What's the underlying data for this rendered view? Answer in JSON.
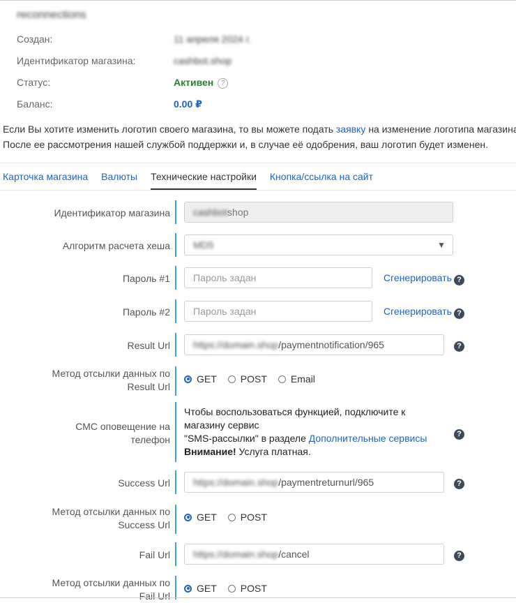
{
  "shop": {
    "title": "reconnections",
    "created_label": "Создан:",
    "created_value": "11 апреля 2024 г.",
    "id_label": "Идентификатор магазина:",
    "id_value": "cashbot.shop",
    "status_label": "Статус:",
    "status_value": "Активен",
    "status_help": "?",
    "balance_label": "Баланс:",
    "balance_value": "0.00 ₽"
  },
  "notice": {
    "line1_before": "Если Вы хотите изменить логотип своего магазина, то вы можете подать ",
    "line1_link": "заявку",
    "line1_after": " на изменение логотипа магазина.",
    "line2": "После ее рассмотрения нашей службой поддержки и, в случае её одобрения, ваш логотип будет изменен."
  },
  "tabs": [
    {
      "label": "Карточка магазина",
      "active": false
    },
    {
      "label": "Валюты",
      "active": false
    },
    {
      "label": "Технические настройки",
      "active": true
    },
    {
      "label": "Кнопка/ссылка на сайт",
      "active": false
    }
  ],
  "form": {
    "shop_id": {
      "label": "Идентификатор магазина",
      "value_blur": "cashbot",
      "value_suffix": "shop"
    },
    "hash_algo": {
      "label": "Алгоритм расчета хеша",
      "value": "MD5",
      "arrow": "▼"
    },
    "password1": {
      "label": "Пароль #1",
      "placeholder": "Пароль задан",
      "generate": "Сгенерировать"
    },
    "password2": {
      "label": "Пароль #2",
      "placeholder": "Пароль задан",
      "generate": "Сгенерировать"
    },
    "result_url": {
      "label": "Result Url",
      "value_blur": "https://domain.shop",
      "value_suffix": "/paymentnotification/965"
    },
    "result_method": {
      "label_line1": "Метод отсылки данных по",
      "label_line2": "Result Url",
      "options": [
        "GET",
        "POST",
        "Email"
      ],
      "selected": "GET"
    },
    "sms": {
      "label_line1": "СМС оповещение на",
      "label_line2": "телефон",
      "line1": "Чтобы воспользоваться функцией, подключите к",
      "line2": "магазину сервис",
      "line3_before": "\"SMS-рассылки\" в разделе ",
      "line3_link": "Дополнительные сервисы",
      "line4_bold": "Внимание!",
      "line4_rest": " Услуга платная."
    },
    "success_url": {
      "label": "Success Url",
      "value_blur": "https://domain.shop",
      "value_suffix": "/paymentreturnurl/965"
    },
    "success_method": {
      "label_line1": "Метод отсылки данных по",
      "label_line2": "Success Url",
      "options": [
        "GET",
        "POST"
      ],
      "selected": "GET"
    },
    "fail_url": {
      "label": "Fail Url",
      "value_blur": "https://domain.shop",
      "value_suffix": "/cancel"
    },
    "fail_method": {
      "label_line1": "Метод отсылки данных по",
      "label_line2": "Fail Url",
      "options": [
        "GET",
        "POST"
      ],
      "selected": "GET"
    },
    "help_glyph": "?"
  }
}
